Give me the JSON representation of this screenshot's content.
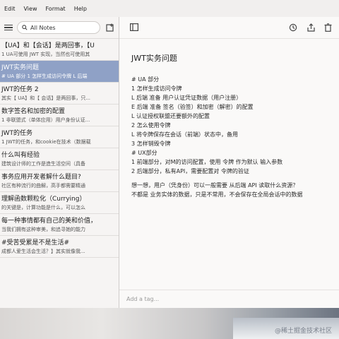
{
  "menu": [
    "Edit",
    "View",
    "Format",
    "Help"
  ],
  "search": {
    "label": "All Notes"
  },
  "notes": [
    {
      "title": "【UA】和【会话】是两回事，【U",
      "preview": "1 UA可使用 JWT 实现，当然也可使用其",
      "selected": false
    },
    {
      "title": "JWT实务问题",
      "preview": "# UA 部分 1 怎样生成访问令牌 L 后端",
      "selected": true
    },
    {
      "title": "JWT的任务 2",
      "preview": "其实【 UA】和【 会话】是两回事，只...",
      "selected": false
    },
    {
      "title": "数字签名和加密的配置",
      "preview": "1 非联盟式（单体应用）用户身份认证...",
      "selected": false
    },
    {
      "title": "JWT的任务",
      "preview": "1 JWT的任务，和cookie在技术（数据载",
      "selected": false
    },
    {
      "title": "什么叫有经验",
      "preview": "建筑设计师的工作是造生活空间（具备",
      "selected": false
    },
    {
      "title": "事务应用开发者解什么题目?",
      "preview": "社区有种流行的曲解，高手都需要精通",
      "selected": false
    },
    {
      "title": "理解函数颗粒化（Currying）",
      "preview": "的关键是，计算功能是什么，可以怎么",
      "selected": false
    },
    {
      "title": "每一种事情都有自己的美和价值，",
      "preview": "当我们拥有这种审美，和追寻她的能力",
      "selected": false
    },
    {
      "title": "#受苦受累是不是生活#",
      "preview": "成都人爱生活会生活？】其实就像我...",
      "selected": false
    }
  ],
  "editor": {
    "title": "JWT实务问题",
    "lines": [
      "# UA 部分",
      "1 怎样生成访问令牌",
      "        L 后端 准备 用户认证凭证数据（用户注册）",
      "        E 后端 准备 签名（验签）和加密（解密）的配置",
      "              L 认证授权联盟还要额外的配置",
      "2 怎么使用令牌",
      "        L 将令牌保存在会话（前端）状态中，备用",
      "3 怎样销毁令牌",
      "# UX部分",
      "1 前端部分，对M的访问配置，使用 令牌 作为默认 输入参数",
      "2 后端部分，私有API，需要配置对 令牌的验证",
      "",
      "想一想，用户（凭身份）可以一般需要 从后端 API 读取什么资源？",
      "不都是 业务实体的数据，只是不常用，不会保存在全局会话中的数据"
    ],
    "tag_placeholder": "Add a tag..."
  },
  "watermark": "@稀土掘金技术社区"
}
